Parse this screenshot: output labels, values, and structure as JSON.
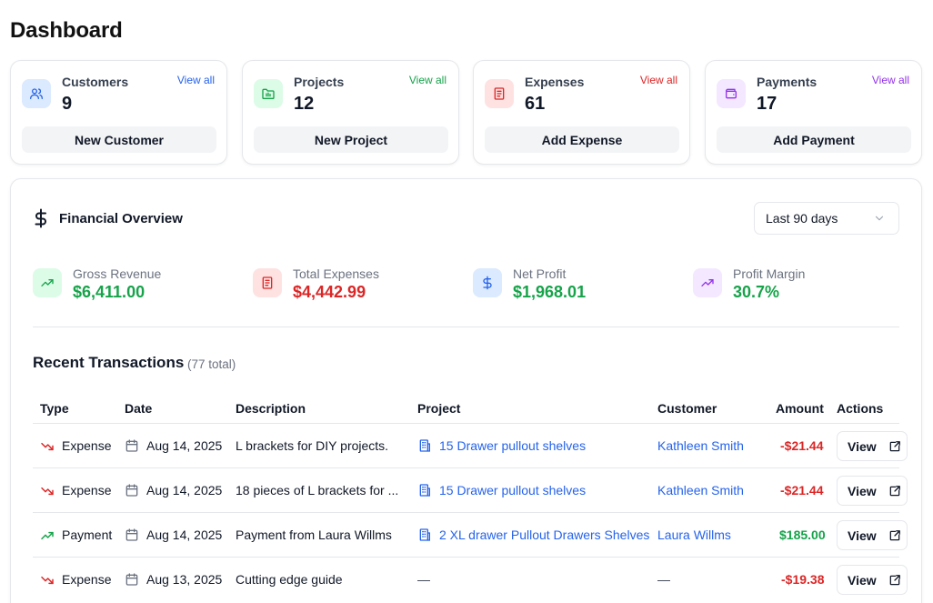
{
  "page": {
    "title": "Dashboard"
  },
  "cards": [
    {
      "label": "Customers",
      "count": "9",
      "view_all": "View all",
      "action": "New Customer",
      "icon": "users-icon",
      "accent": "#2563eb",
      "icon_bg": "#dbeafe"
    },
    {
      "label": "Projects",
      "count": "12",
      "view_all": "View all",
      "action": "New Project",
      "icon": "folder-icon",
      "accent": "#16a34a",
      "icon_bg": "#dcfce7"
    },
    {
      "label": "Expenses",
      "count": "61",
      "view_all": "View all",
      "action": "Add Expense",
      "icon": "receipt-icon",
      "accent": "#dc2626",
      "icon_bg": "#fee2e2"
    },
    {
      "label": "Payments",
      "count": "17",
      "view_all": "View all",
      "action": "Add Payment",
      "icon": "wallet-icon",
      "accent": "#9333ea",
      "icon_bg": "#f3e8ff"
    }
  ],
  "overview": {
    "title": "Financial Overview",
    "range": "Last 90 days",
    "metrics": [
      {
        "label": "Gross Revenue",
        "value": "$6,411.00",
        "color": "#16a34a",
        "icon": "trending-up-icon"
      },
      {
        "label": "Total Expenses",
        "value": "$4,442.99",
        "color": "#dc2626",
        "icon": "receipt-icon"
      },
      {
        "label": "Net Profit",
        "value": "$1,968.01",
        "color": "#16a34a",
        "icon": "dollar-icon"
      },
      {
        "label": "Profit Margin",
        "value": "30.7%",
        "color": "#16a34a",
        "icon": "trending-up-icon"
      }
    ]
  },
  "transactions": {
    "title": "Recent Transactions",
    "count": "(77 total)",
    "headers": {
      "type": "Type",
      "date": "Date",
      "description": "Description",
      "project": "Project",
      "customer": "Customer",
      "amount": "Amount",
      "actions": "Actions"
    },
    "rows": [
      {
        "type": "Expense",
        "date": "Aug 14, 2025",
        "description": "L brackets for DIY projects.",
        "project": "15 Drawer pullout shelves",
        "customer": "Kathleen Smith",
        "amount": "-$21.44",
        "view": "View"
      },
      {
        "type": "Expense",
        "date": "Aug 14, 2025",
        "description": "18 pieces of L brackets for ...",
        "project": "15 Drawer pullout shelves",
        "customer": "Kathleen Smith",
        "amount": "-$21.44",
        "view": "View"
      },
      {
        "type": "Payment",
        "date": "Aug 14, 2025",
        "description": "Payment from Laura Willms",
        "project": "2 XL drawer Pullout Drawers Shelves",
        "customer": "Laura Willms",
        "amount": "$185.00",
        "view": "View"
      },
      {
        "type": "Expense",
        "date": "Aug 13, 2025",
        "description": "Cutting edge guide",
        "project": "—",
        "customer": "—",
        "amount": "-$19.38",
        "view": "View"
      }
    ]
  }
}
